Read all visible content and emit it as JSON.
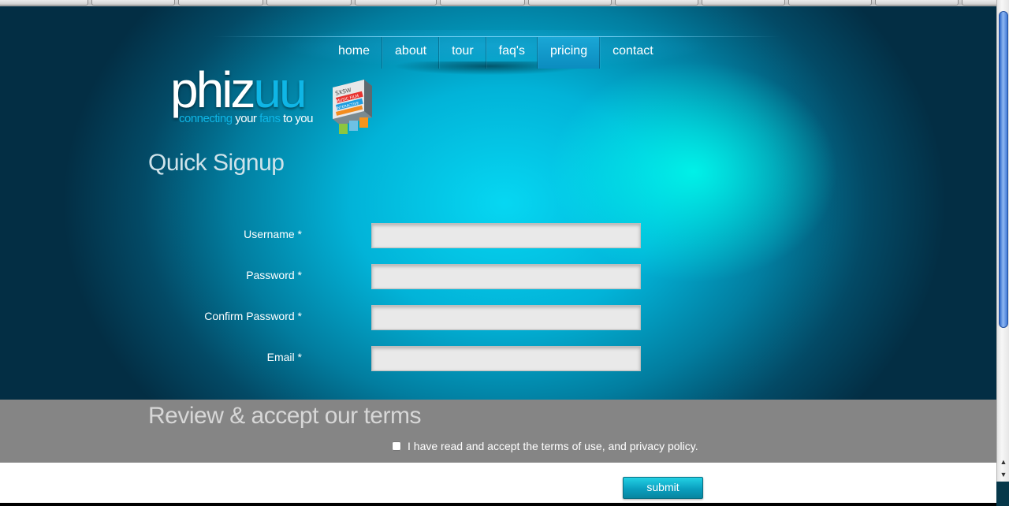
{
  "nav": {
    "items": [
      {
        "label": "home"
      },
      {
        "label": "about"
      },
      {
        "label": "tour"
      },
      {
        "label": "faq's"
      },
      {
        "label": "pricing",
        "active": true
      },
      {
        "label": "contact"
      }
    ]
  },
  "logo": {
    "word_main": "phiz",
    "word_accent": "uu",
    "tagline_part1": "connecting ",
    "tagline_part2": "your ",
    "tagline_part3": "fans ",
    "tagline_part4": "to you",
    "badge_text": [
      "SXSW",
      "MUSIC FILM",
      "INTERACTIVE"
    ]
  },
  "signup": {
    "title": "Quick Signup",
    "fields": [
      {
        "label": "Username *",
        "value": ""
      },
      {
        "label": "Password *",
        "value": ""
      },
      {
        "label": "Confirm Password *",
        "value": ""
      },
      {
        "label": "Email *",
        "value": ""
      }
    ]
  },
  "terms": {
    "title": "Review & accept our terms",
    "checkbox_label": "I have read and accept the terms of use, and privacy policy.",
    "checked": false
  },
  "submit": {
    "label": "submit"
  },
  "scrollbar": {
    "up_label": "▲",
    "down_label": "▼"
  },
  "colors": {
    "accent": "#0fb6e6",
    "glow": "#00ffee",
    "terms_band": "#858585",
    "nav_active": "#1aa7d6"
  }
}
